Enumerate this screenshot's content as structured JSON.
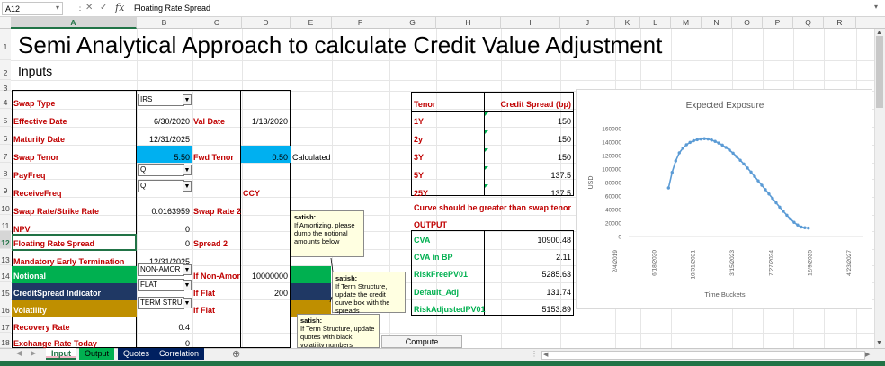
{
  "formula_bar": {
    "cell_ref": "A12",
    "formula": "Floating Rate Spread",
    "fx": "fx",
    "cancel": "✕",
    "enter": "✓"
  },
  "columns": [
    "A",
    "B",
    "C",
    "D",
    "E",
    "F",
    "G",
    "H",
    "I",
    "J",
    "K",
    "L",
    "M",
    "N",
    "O",
    "P",
    "Q",
    "R"
  ],
  "rows": [
    "1",
    "2",
    "3",
    "4",
    "5",
    "6",
    "7",
    "8",
    "9",
    "10",
    "11",
    "12",
    "13",
    "14",
    "15",
    "16",
    "17",
    "18"
  ],
  "sheet": {
    "title": "Semi Analytical Approach to calculate Credit Value Adjustment",
    "inputs_heading": "Inputs",
    "swap_type": {
      "label": "Swap Type",
      "value": "IRS"
    },
    "effective_date": {
      "label": "Effective Date",
      "value": "6/30/2020"
    },
    "val_date": {
      "label": "Val Date",
      "value": "1/13/2020"
    },
    "maturity_date": {
      "label": "Maturity Date",
      "value": "12/31/2025"
    },
    "swap_tenor": {
      "label": "Swap Tenor",
      "value": "5.50"
    },
    "fwd_tenor": {
      "label": "Fwd Tenor",
      "value": "0.50",
      "note": "Calculated"
    },
    "pay_freq": {
      "label": "PayFreq",
      "value": "Q"
    },
    "receive_freq": {
      "label": "ReceiveFreq",
      "value": "Q"
    },
    "ccy": "CCY",
    "swap_rate": {
      "label": "Swap Rate/Strike Rate",
      "value": "0.0163959"
    },
    "swap_rate_2": {
      "label": "Swap Rate 2"
    },
    "npv": {
      "label": "NPV",
      "value": "0"
    },
    "floating_rate_spread": {
      "label": "Floating Rate Spread",
      "value": "0"
    },
    "spread_2": {
      "label": "Spread 2"
    },
    "mandatory_early_termination": {
      "label": "Mandatory Early Termination",
      "value": "12/31/2025"
    },
    "notional": {
      "label": "Notional",
      "value": "NON-AMOR"
    },
    "if_non_amor": {
      "label": "If Non-Amor",
      "value": "10000000"
    },
    "credit_spread_indicator": {
      "label": "CreditSpread Indicator",
      "value": "FLAT"
    },
    "if_flat_1": {
      "label": "If Flat",
      "value": "200"
    },
    "volatility": {
      "label": "Volatility",
      "value": "TERM STRUC"
    },
    "if_flat_2": {
      "label": "If Flat"
    },
    "recovery_rate": {
      "label": "Recovery Rate",
      "value": "0.4"
    },
    "exchange_rate": {
      "label": "Exchange Rate Today",
      "value": "0"
    }
  },
  "notes": [
    {
      "author": "satish:",
      "text": "If Amortizing, please dump the notional amounts below"
    },
    {
      "author": "satish:",
      "text": "If Term Structure, update the credit curve box with the spreads"
    },
    {
      "author": "satish:",
      "text": "If Term Structure, update quotes with black volatility numbers"
    }
  ],
  "credit_table": {
    "headers": [
      "Tenor",
      "Credit Spread (bp)"
    ],
    "rows": [
      {
        "tenor": "1Y",
        "spread": "150"
      },
      {
        "tenor": "2y",
        "spread": "150"
      },
      {
        "tenor": "3Y",
        "spread": "150"
      },
      {
        "tenor": "5Y",
        "spread": "137.5"
      },
      {
        "tenor": "25Y",
        "spread": "137.5"
      }
    ],
    "warning": "Curve should be greater than swap tenor"
  },
  "output": {
    "heading": "OUTPUT",
    "rows": [
      {
        "label": "CVA",
        "value": "10900.48"
      },
      {
        "label": "CVA in BP",
        "value": "2.11"
      },
      {
        "label": "RiskFreePV01",
        "value": "5285.63"
      },
      {
        "label": "Default_Adj",
        "value": "131.74"
      },
      {
        "label": "RiskAdjustedPV01",
        "value": "5153.89"
      }
    ]
  },
  "compute_button": "Compute",
  "tabs": [
    {
      "label": "Input",
      "active": true,
      "color": "#ffffff"
    },
    {
      "label": "Output",
      "active": false,
      "color": "#00b050"
    },
    {
      "label": "Quotes",
      "active": false,
      "color": "#002060"
    },
    {
      "label": "Correlation",
      "active": false,
      "color": "#002060"
    }
  ],
  "colors": {
    "red": "#c00000",
    "green": "#00b050",
    "blue": "#00b0f0",
    "navy": "#1f3864",
    "olive": "#bf8f00",
    "line": "#5b9bd5"
  },
  "chart_data": {
    "type": "line",
    "title": "Expected Exposure",
    "xlabel": "Time Buckets",
    "ylabel": "USD",
    "x_tick_labels": [
      "2/4/2019",
      "6/18/2020",
      "10/31/2021",
      "3/15/2023",
      "7/27/2024",
      "12/9/2025",
      "4/23/2027"
    ],
    "x_range_days": [
      0,
      2999
    ],
    "ylim": [
      0,
      160000
    ],
    "y_ticks": [
      "0",
      "20000",
      "40000",
      "60000",
      "80000",
      "100000",
      "120000",
      "140000",
      "160000"
    ],
    "series": [
      {
        "x_days": [
          511,
          557,
          603,
          649,
          695,
          741,
          787,
          833,
          879,
          925,
          971,
          1017,
          1063,
          1109,
          1155,
          1201,
          1247,
          1293,
          1339,
          1385,
          1431,
          1477,
          1523,
          1569,
          1615,
          1661,
          1707,
          1753,
          1799,
          1845,
          1891,
          1937,
          1983,
          2029,
          2075,
          2121,
          2167,
          2213,
          2259,
          2305
        ],
        "values": [
          72000,
          95000,
          112000,
          124000,
          131000,
          136000,
          139500,
          142000,
          143500,
          144500,
          145000,
          144500,
          143000,
          141000,
          138500,
          135500,
          132000,
          128000,
          123500,
          118500,
          113000,
          107500,
          101500,
          95500,
          89000,
          82500,
          76000,
          69500,
          63000,
          56500,
          50000,
          43500,
          37500,
          31500,
          26000,
          21000,
          17000,
          14000,
          13000,
          12500
        ]
      }
    ]
  }
}
